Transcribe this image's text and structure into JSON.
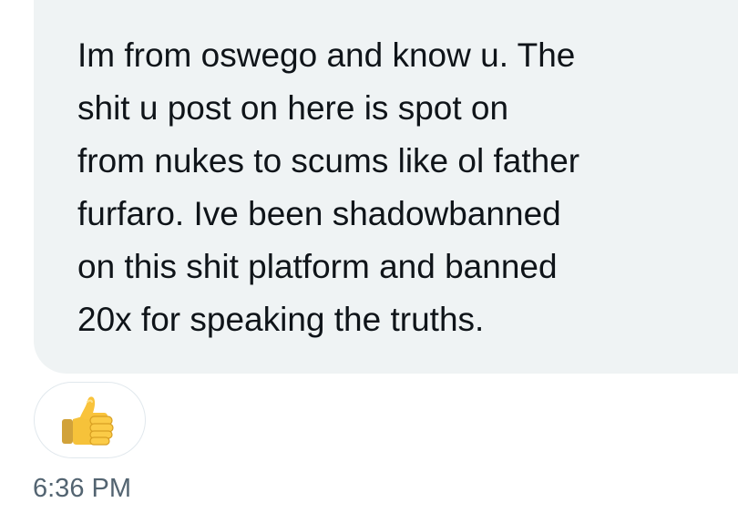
{
  "message": {
    "lines": [
      "Im from oswego and know u. The",
      "shit u post on here is spot on",
      "from nukes to scums like ol father",
      "furfaro. Ive been shadowbanned",
      "on this shit platform and banned",
      "20x for speaking the truths."
    ],
    "reaction": {
      "icon": "thumbs-up-icon"
    },
    "timestamp": "6:36 PM"
  },
  "colors": {
    "bubble_background": "#eff3f4",
    "text": "#0f1419",
    "timestamp": "#536471",
    "reaction_border": "#e1e8ed"
  }
}
